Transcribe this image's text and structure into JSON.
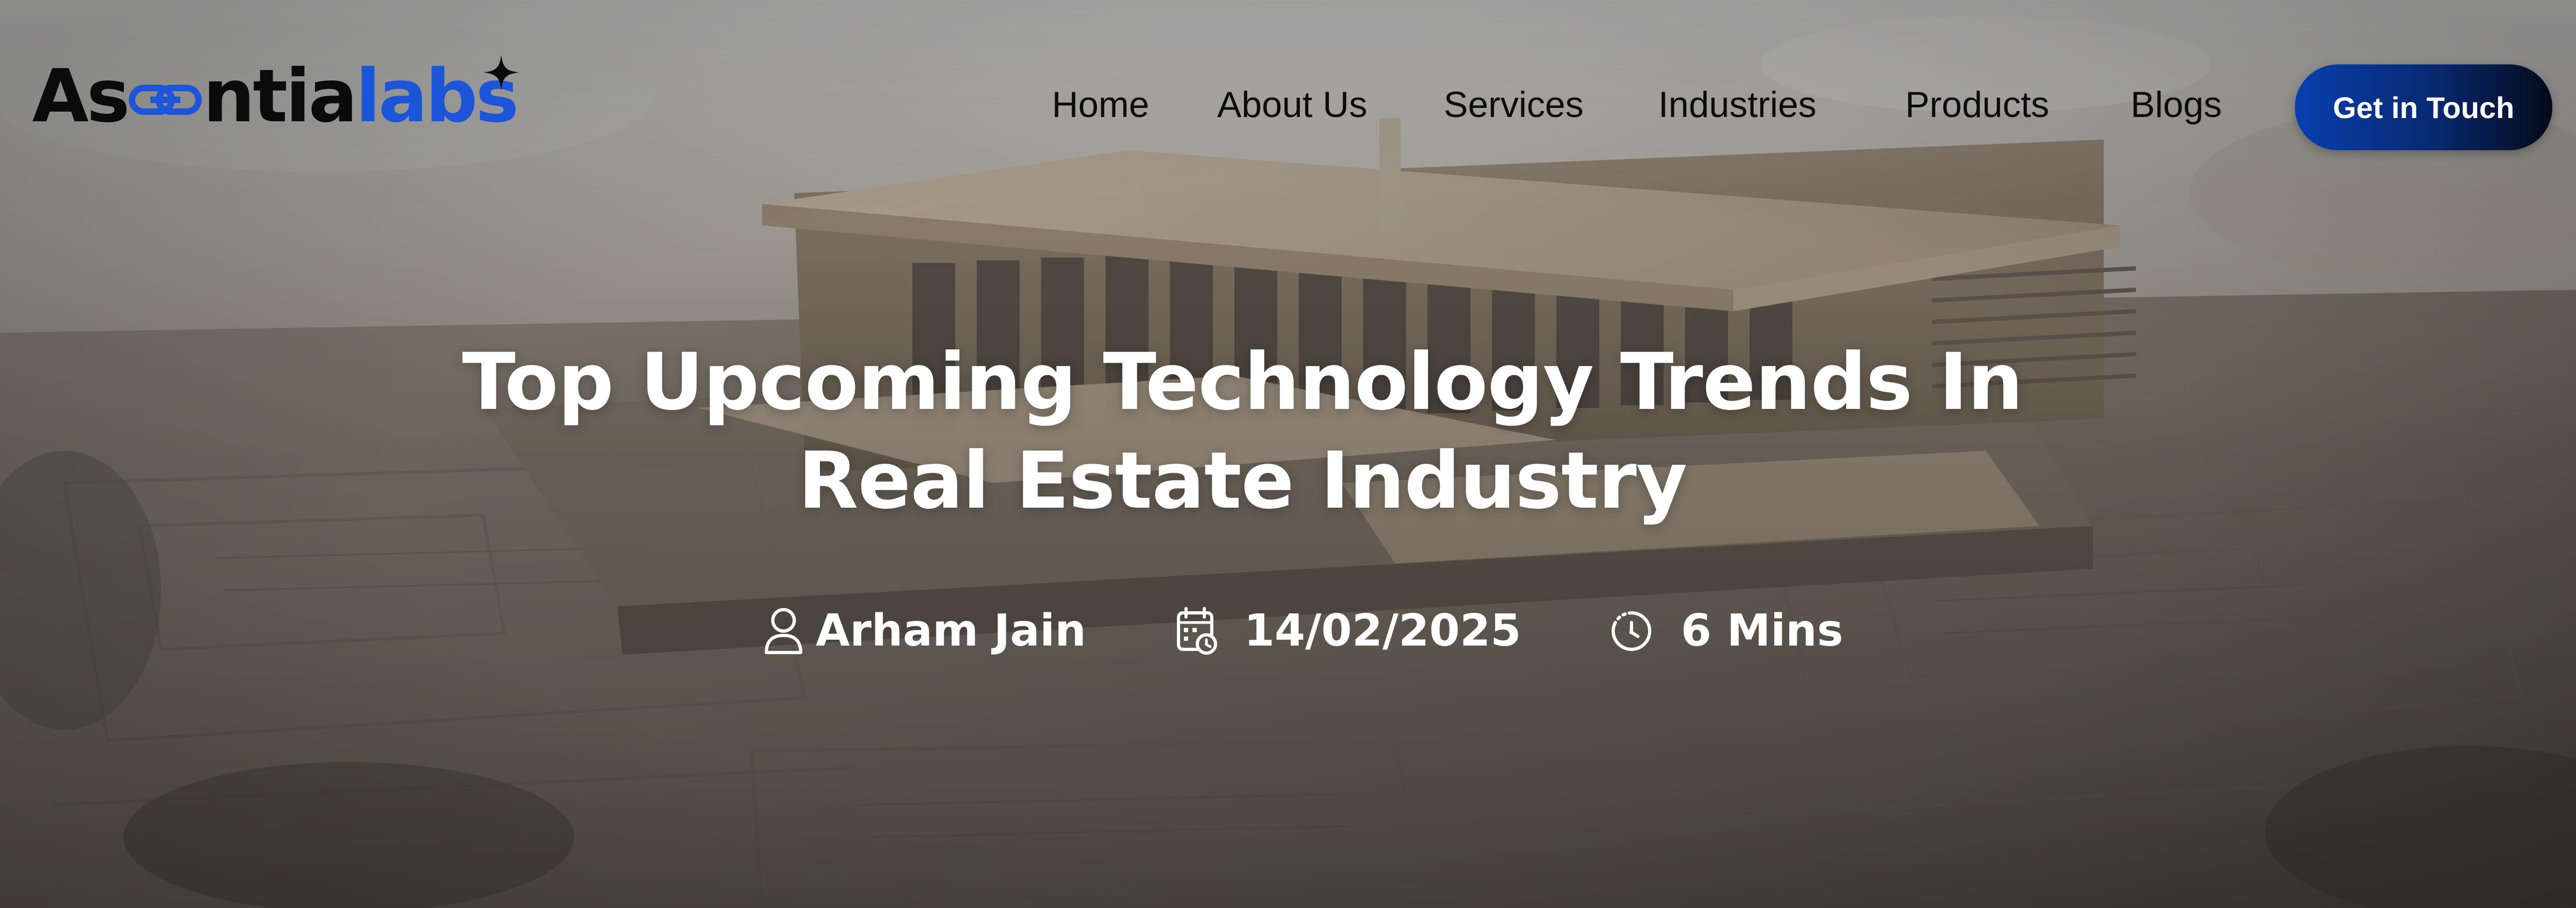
{
  "brand": {
    "logo_part1": "As",
    "logo_part2": "ntia",
    "logo_part3": "labs",
    "primary_color": "#1c55d8",
    "dark_color": "#0b0b0c"
  },
  "nav": {
    "items": [
      {
        "label": "Home"
      },
      {
        "label": "About Us"
      },
      {
        "label": "Services"
      },
      {
        "label": "Industries"
      },
      {
        "label": "Products"
      },
      {
        "label": "Blogs"
      }
    ],
    "cta_label": "Get in Touch"
  },
  "hero": {
    "title_line1": "Top Upcoming Technology Trends In",
    "title_line2": "Real Estate Industry",
    "author": "Arham Jain",
    "date": "14/02/2025",
    "read_time": "6 Mins",
    "icons": {
      "author": "user-icon",
      "date": "calendar-clock-icon",
      "read_time": "timer-icon"
    }
  }
}
